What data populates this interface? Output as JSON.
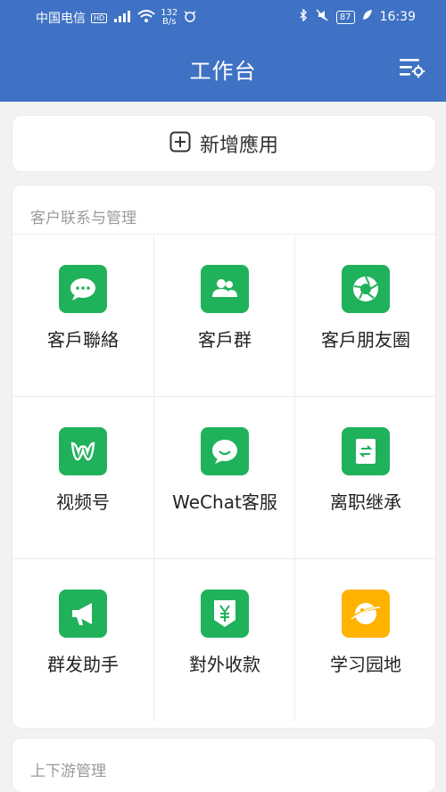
{
  "status": {
    "carrier": "中国电信",
    "speed_value": "132",
    "speed_unit": "B/s",
    "battery": "87",
    "time": "16:39"
  },
  "header": {
    "title": "工作台"
  },
  "add_app": {
    "label": "新增應用"
  },
  "section1": {
    "title": "客户联系与管理",
    "apps": [
      {
        "label": "客戶聯絡",
        "icon": "chat-bubble-icon"
      },
      {
        "label": "客戶群",
        "icon": "group-icon"
      },
      {
        "label": "客戶朋友圈",
        "icon": "aperture-icon"
      },
      {
        "label": "视频号",
        "icon": "channels-icon"
      },
      {
        "label": "WeChat客服",
        "icon": "customer-service-icon"
      },
      {
        "label": "离职继承",
        "icon": "transfer-doc-icon"
      },
      {
        "label": "群发助手",
        "icon": "megaphone-icon"
      },
      {
        "label": "對外收款",
        "icon": "yuan-shield-icon"
      },
      {
        "label": "学习园地",
        "icon": "planet-icon"
      }
    ]
  },
  "section2": {
    "title": "上下游管理"
  },
  "colors": {
    "header_blue": "#3f72c4",
    "app_green": "#20b15b",
    "app_orange": "#ffb300"
  }
}
